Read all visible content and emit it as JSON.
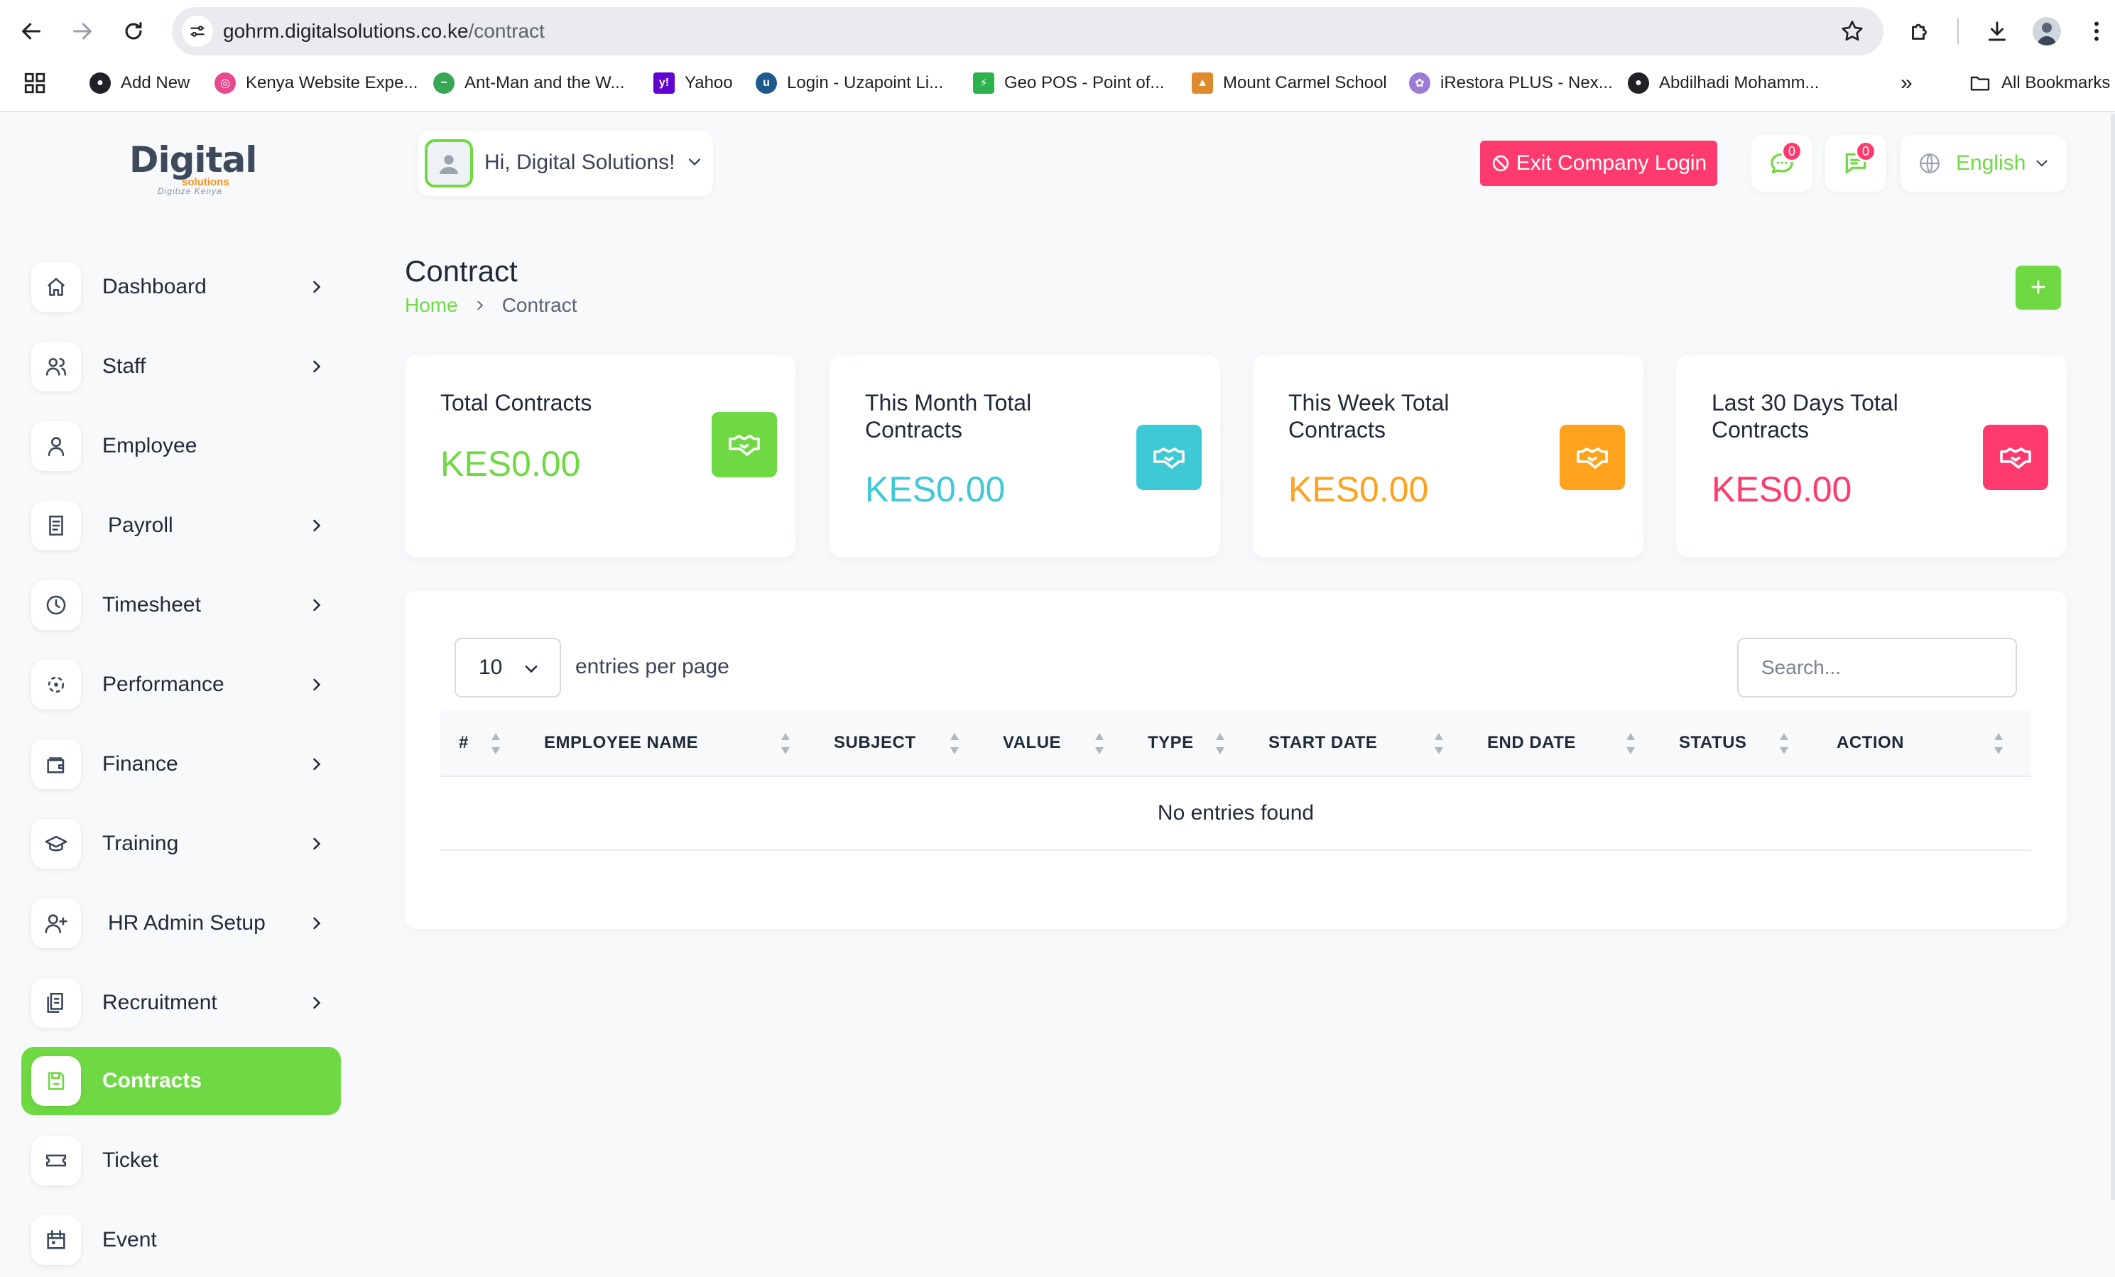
{
  "browser": {
    "url_host": "gohrm.digitalsolutions.co.ke",
    "url_path": "/contract",
    "bookmarks": [
      {
        "label": "Add New",
        "color": "#202124"
      },
      {
        "label": "Kenya Website Expe...",
        "color": "#e7498c"
      },
      {
        "label": "Ant-Man and the W...",
        "color": "#3aa757"
      },
      {
        "label": "Yahoo",
        "color": "#6001d2"
      },
      {
        "label": "Login - Uzapoint Li...",
        "color": "#1d5b8f"
      },
      {
        "label": "Geo POS - Point of...",
        "color": "#2bb24c"
      },
      {
        "label": "Mount Carmel School",
        "color": "#e08a2e"
      },
      {
        "label": "iRestora PLUS - Nex...",
        "color": "#9b7bd6"
      },
      {
        "label": "Abdilhadi Mohamm...",
        "color": "#202124"
      }
    ],
    "all_bookmarks_label": "All Bookmarks"
  },
  "logo": {
    "main": "Digital",
    "sub": "solutions",
    "tagline": "Digitize Kenya"
  },
  "sidebar": {
    "items": [
      {
        "label": "Dashboard",
        "icon": "home-icon",
        "chevron": true
      },
      {
        "label": "Staff",
        "icon": "users-icon",
        "chevron": true
      },
      {
        "label": "Employee",
        "icon": "user-icon",
        "chevron": false
      },
      {
        "label": "Payroll",
        "icon": "receipt-icon",
        "chevron": true
      },
      {
        "label": "Timesheet",
        "icon": "clock-icon",
        "chevron": true
      },
      {
        "label": "Performance",
        "icon": "target-icon",
        "chevron": true
      },
      {
        "label": "Finance",
        "icon": "wallet-icon",
        "chevron": true
      },
      {
        "label": "Training",
        "icon": "graduation-cap-icon",
        "chevron": true
      },
      {
        "label": "HR Admin Setup",
        "icon": "user-plus-icon",
        "chevron": true
      },
      {
        "label": "Recruitment",
        "icon": "clipboard-icon",
        "chevron": true
      },
      {
        "label": "Contracts",
        "icon": "device-floppy-icon",
        "chevron": false,
        "active": true
      },
      {
        "label": "Ticket",
        "icon": "ticket-icon",
        "chevron": false
      },
      {
        "label": "Event",
        "icon": "calendar-icon",
        "chevron": false
      }
    ]
  },
  "header": {
    "greeting": "Hi, Digital Solutions!",
    "exit_label": "Exit Company Login",
    "messages_badge": "0",
    "notifications_badge": "0",
    "language": "English"
  },
  "page": {
    "title": "Contract",
    "breadcrumb_home": "Home",
    "breadcrumb_current": "Contract",
    "add_label": "+"
  },
  "cards": [
    {
      "title": "Total Contracts",
      "value": "KES0.00",
      "color": "#6fd943"
    },
    {
      "title": "This Month Total Contracts",
      "value": "KES0.00",
      "color": "#3ec9d6"
    },
    {
      "title": "This Week Total Contracts",
      "value": "KES0.00",
      "color": "#ffa21d"
    },
    {
      "title": "Last 30 Days Total Contracts",
      "value": "KES0.00",
      "color": "#ff3a6e"
    }
  ],
  "table": {
    "per_page": "10",
    "per_page_label": "entries per page",
    "search_placeholder": "Search...",
    "columns": [
      "#",
      "EMPLOYEE NAME",
      "SUBJECT",
      "VALUE",
      "TYPE",
      "START DATE",
      "END DATE",
      "STATUS",
      "ACTION"
    ],
    "empty_text": "No entries found"
  },
  "colors": {
    "accent": "#6fd943",
    "danger": "#ff3a6e",
    "info": "#3ec9d6",
    "warning": "#ffa21d"
  }
}
